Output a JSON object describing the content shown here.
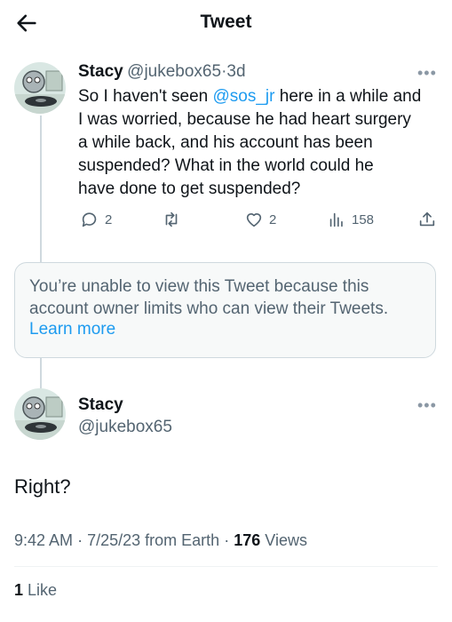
{
  "header": {
    "title": "Tweet",
    "back_icon": "arrow-left-icon"
  },
  "parent_tweet": {
    "name": "Stacy",
    "handle": "@jukebox65",
    "separator": "·",
    "time": "3d",
    "text_lines": [
      {
        "pre": "So I haven't seen ",
        "mention": "@sos_jr",
        "post": " here in a while and"
      },
      {
        "pre": "I was worried, because he had heart surgery"
      },
      {
        "pre": "a while back, and his account has been"
      },
      {
        "pre": "suspended? What in the world could he"
      },
      {
        "pre": "have done to get suspended?"
      }
    ],
    "actions": {
      "replies": "2",
      "retweets": "",
      "likes": "2",
      "views": "158"
    }
  },
  "limited_card": {
    "line1": "You’re unable to view this Tweet because this",
    "line2": "account owner limits who can view their Tweets.",
    "link": "Learn more"
  },
  "main_tweet": {
    "name": "Stacy",
    "handle": "@jukebox65",
    "text": "Right?",
    "time": "9:42 AM",
    "sep1": "·",
    "date": "7/25/23",
    "source": "from Earth",
    "sep2": "·",
    "views_count": "176",
    "views_label": "Views",
    "likes_count": "1",
    "likes_label": "Like"
  },
  "colors": {
    "accent": "#1d9bf0",
    "muted": "#536471",
    "border": "#cfd9de"
  }
}
